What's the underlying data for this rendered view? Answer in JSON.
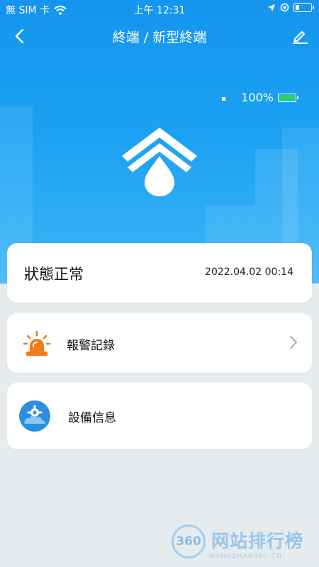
{
  "status_bar": {
    "carrier": "無 SIM 卡",
    "time": "上午 12:31",
    "icons": [
      "wifi-icon",
      "location-arrow-icon",
      "orientation-lock-icon",
      "battery-icon"
    ]
  },
  "nav": {
    "back_icon": "chevron-left-icon",
    "title": "終端 / 新型終端",
    "edit_icon": "pencil-icon"
  },
  "device": {
    "battery_level": "100%",
    "battery_fill_fraction": 1.0,
    "battery_color": "#22d36a",
    "logo_icon": "water-drop-chevron-logo"
  },
  "status_card": {
    "status": "狀態正常",
    "timestamp": "2022.04.02 00:14"
  },
  "alarm_card": {
    "icon": "alarm-siren-icon",
    "label": "報警記錄",
    "arrow_icon": "chevron-right-icon",
    "icon_color": "#f07d1a"
  },
  "info_card": {
    "icon": "gear-cloud-icon",
    "label": "設備信息",
    "icon_color": "#2b8fe4"
  },
  "watermark": {
    "badge": "360",
    "text": "网站排行榜",
    "subtext": "-WANGZHAN360.CN-"
  },
  "colors": {
    "header_blue": "#1595ee",
    "background": "#e6ebee"
  }
}
